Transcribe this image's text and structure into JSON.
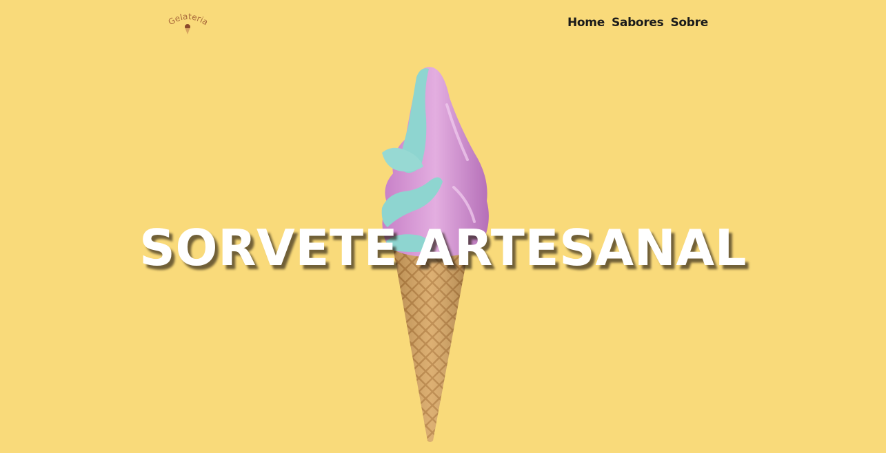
{
  "header": {
    "logo_text": "Gelateria",
    "nav": [
      {
        "label": "Home"
      },
      {
        "label": "Sabores"
      },
      {
        "label": "Sobre"
      }
    ]
  },
  "hero": {
    "title": "SORVETE ARTESANAL",
    "image_icon": "ice-cream-cone-icon"
  },
  "colors": {
    "background": "#F9DA7A",
    "nav_text": "#1a1a1a",
    "title_text": "#ffffff",
    "logo_brown": "#A8683A",
    "cone": "#D8A560",
    "swirl_pink": "#D99AD6",
    "swirl_teal": "#8ED5D0"
  }
}
